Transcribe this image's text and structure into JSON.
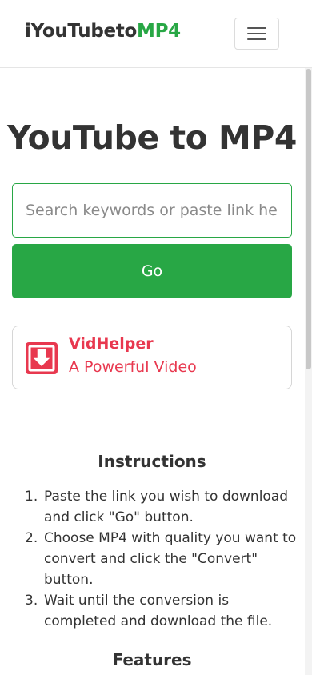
{
  "header": {
    "brand_prefix": "iYouTubeto",
    "brand_accent": "MP4",
    "menu_icon": "hamburger-menu-icon"
  },
  "hero": {
    "title": "YouTube to MP4"
  },
  "search": {
    "placeholder": "Search keywords or paste link here",
    "value": ""
  },
  "go_button": {
    "label": "Go"
  },
  "promo": {
    "icon": "download-arrow-icon",
    "title": "VidHelper",
    "subtitle": "A Powerful Video"
  },
  "instructions": {
    "title": "Instructions",
    "steps": [
      {
        "num": "1.",
        "text": "Paste the link you wish to download and click \"Go\" button."
      },
      {
        "num": "2.",
        "text": "Choose MP4 with quality you want to convert and click the \"Convert\" button."
      },
      {
        "num": "3.",
        "text": "Wait until the conversion is completed and download the file."
      }
    ]
  },
  "features": {
    "title": "Features"
  },
  "colors": {
    "accent_green": "#28a745",
    "promo_red": "#e8384f",
    "text": "#333333"
  }
}
